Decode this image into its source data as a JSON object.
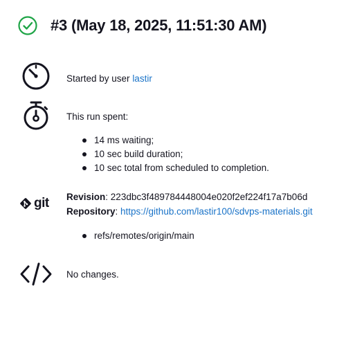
{
  "header": {
    "status_icon": "check-circle-icon",
    "status_color": "#1ea446",
    "title": "#3 (May 18, 2025, 11:51:30 AM)"
  },
  "started": {
    "icon": "clock-icon",
    "prefix": "Started by user ",
    "user": "lastir"
  },
  "timing": {
    "icon": "stopwatch-icon",
    "heading": "This run spent:",
    "items": [
      "14 ms waiting;",
      "10 sec build duration;",
      "10 sec total from scheduled to completion."
    ]
  },
  "git": {
    "icon": "git-logo-icon",
    "logo_text": "git",
    "revision_label": "Revision",
    "revision_value": "223dbc3f489784448004e020f2ef224f17a7b06d",
    "repository_label": "Repository",
    "repository_url": "https://github.com/lastir100/sdvps-materials.git",
    "branches": [
      "refs/remotes/origin/main"
    ]
  },
  "changes": {
    "icon": "code-brackets-icon",
    "text": "No changes."
  },
  "colors": {
    "link": "#1a73c8",
    "text": "#14141f"
  }
}
